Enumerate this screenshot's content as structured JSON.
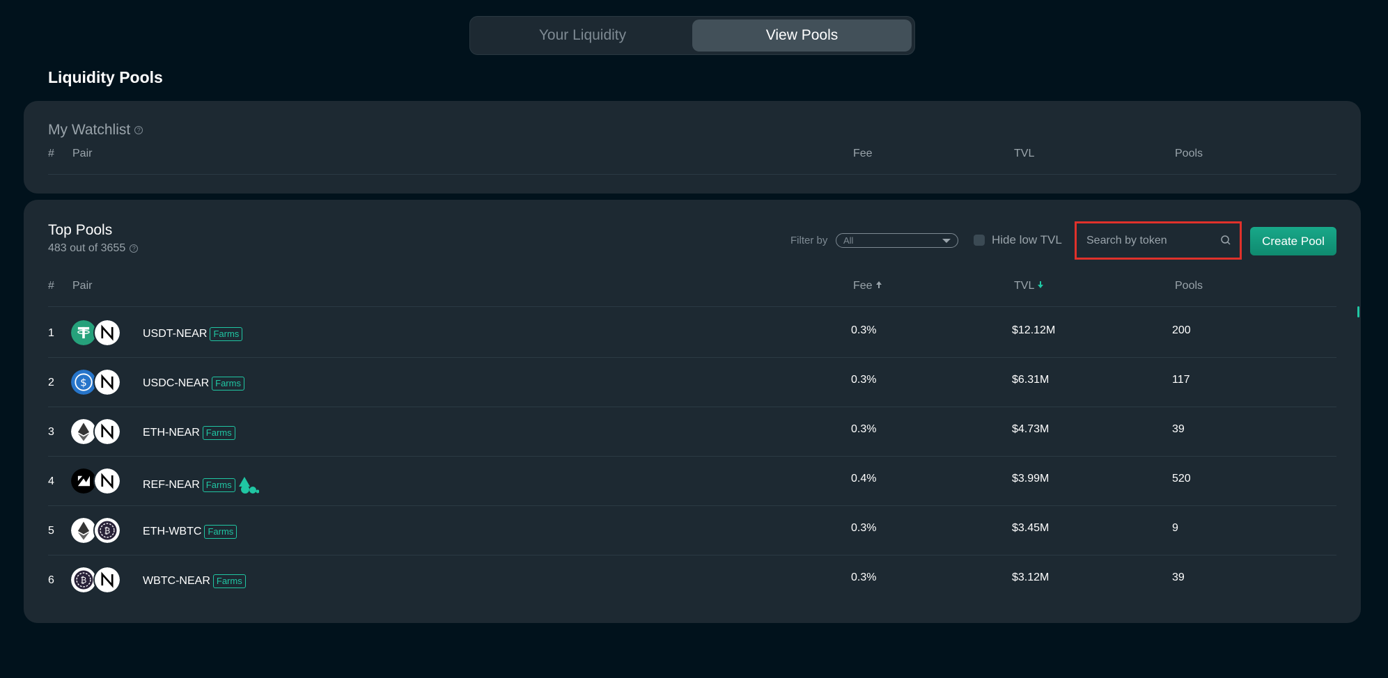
{
  "tabs": [
    {
      "label": "Your Liquidity"
    },
    {
      "label": "View Pools"
    }
  ],
  "page_title": "Liquidity Pools",
  "watchlist": {
    "title": "My Watchlist",
    "columns": {
      "index": "#",
      "pair": "Pair",
      "fee": "Fee",
      "tvl": "TVL",
      "pools": "Pools"
    }
  },
  "top_pools": {
    "title": "Top Pools",
    "count": "483 out of 3655",
    "filter_label": "Filter by",
    "filter_value": "All",
    "hide_low_tvl": "Hide low TVL",
    "search_placeholder": "Search by token",
    "create_pool": "Create Pool",
    "columns": {
      "index": "#",
      "pair": "Pair",
      "fee": "Fee",
      "tvl": "TVL",
      "pools": "Pools"
    },
    "rows": [
      {
        "index": "1",
        "pair": "USDT-NEAR",
        "badge": "Farms",
        "fee": "0.3%",
        "tvl": "$12.12M",
        "pools": "200"
      },
      {
        "index": "2",
        "pair": "USDC-NEAR",
        "badge": "Farms",
        "fee": "0.3%",
        "tvl": "$6.31M",
        "pools": "117"
      },
      {
        "index": "3",
        "pair": "ETH-NEAR",
        "badge": "Farms",
        "fee": "0.3%",
        "tvl": "$4.73M",
        "pools": "39"
      },
      {
        "index": "4",
        "pair": "REF-NEAR",
        "badge": "Farms",
        "fee": "0.4%",
        "tvl": "$3.99M",
        "pools": "520"
      },
      {
        "index": "5",
        "pair": "ETH-WBTC",
        "badge": "Farms",
        "fee": "0.3%",
        "tvl": "$3.45M",
        "pools": "9"
      },
      {
        "index": "6",
        "pair": "WBTC-NEAR",
        "badge": "Farms",
        "fee": "0.3%",
        "tvl": "$3.12M",
        "pools": "39"
      }
    ]
  },
  "colors": {
    "background": "#01121c",
    "card": "#1d2932",
    "accent": "#20c6a3",
    "highlight_border": "#e0312b"
  }
}
